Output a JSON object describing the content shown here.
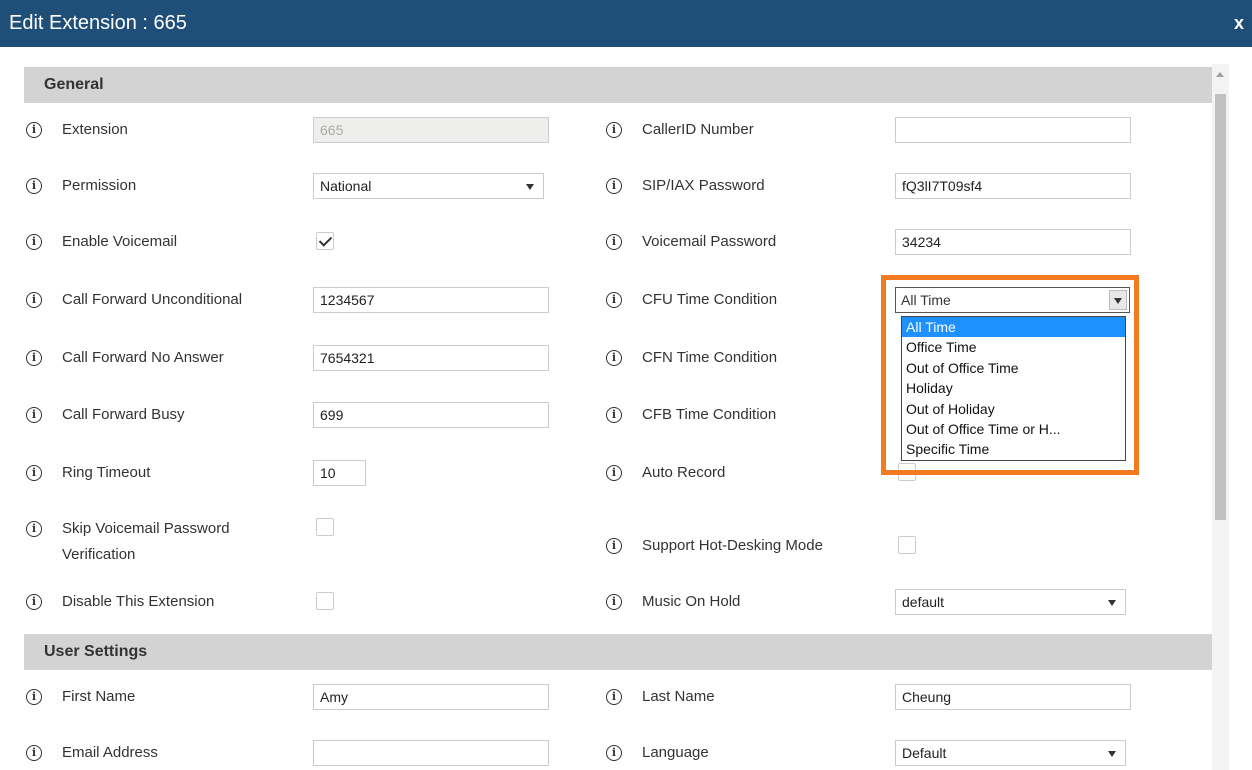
{
  "window": {
    "title": "Edit Extension : 665",
    "close_label": "x"
  },
  "sections": {
    "general": "General",
    "user_settings": "User Settings"
  },
  "info_glyph": "i",
  "left": {
    "extension": {
      "label": "Extension",
      "value": "665"
    },
    "permission": {
      "label": "Permission",
      "value": "National"
    },
    "enable_voicemail": {
      "label": "Enable Voicemail",
      "checked": true
    },
    "cfu": {
      "label": "Call Forward Unconditional",
      "value": "1234567"
    },
    "cfn": {
      "label": "Call Forward No Answer",
      "value": "7654321"
    },
    "cfb": {
      "label": "Call Forward Busy",
      "value": "699"
    },
    "ring_timeout": {
      "label": "Ring Timeout",
      "value": "10"
    },
    "skip_vm": {
      "label_line1": "Skip Voicemail Password",
      "label_line2": "Verification",
      "checked": false
    },
    "disable_ext": {
      "label": "Disable This Extension",
      "checked": false
    },
    "first_name": {
      "label": "First Name",
      "value": "Amy"
    },
    "email": {
      "label": "Email Address",
      "value": ""
    }
  },
  "right": {
    "callerid": {
      "label": "CallerID Number",
      "value": ""
    },
    "sip_password": {
      "label": "SIP/IAX Password",
      "value": "fQ3lI7T09sf4"
    },
    "vm_password": {
      "label": "Voicemail Password",
      "value": "34234"
    },
    "cfu_time": {
      "label": "CFU Time Condition",
      "value": "All Time"
    },
    "cfn_time": {
      "label": "CFN Time Condition"
    },
    "cfb_time": {
      "label": "CFB Time Condition"
    },
    "auto_record": {
      "label": "Auto Record",
      "checked": false
    },
    "hot_desking": {
      "label": "Support Hot-Desking Mode",
      "checked": false
    },
    "moh": {
      "label": "Music On Hold",
      "value": "default"
    },
    "last_name": {
      "label": "Last Name",
      "value": "Cheung"
    },
    "language": {
      "label": "Language",
      "value": "Default"
    }
  },
  "time_condition_options": [
    "All Time",
    "Office Time",
    "Out of Office Time",
    "Holiday",
    "Out of Holiday",
    "Out of Office Time or H...",
    "Specific Time"
  ],
  "colors": {
    "titlebar": "#1f4e79",
    "highlight": "#f47a20",
    "selected_option": "#1e90ff"
  }
}
